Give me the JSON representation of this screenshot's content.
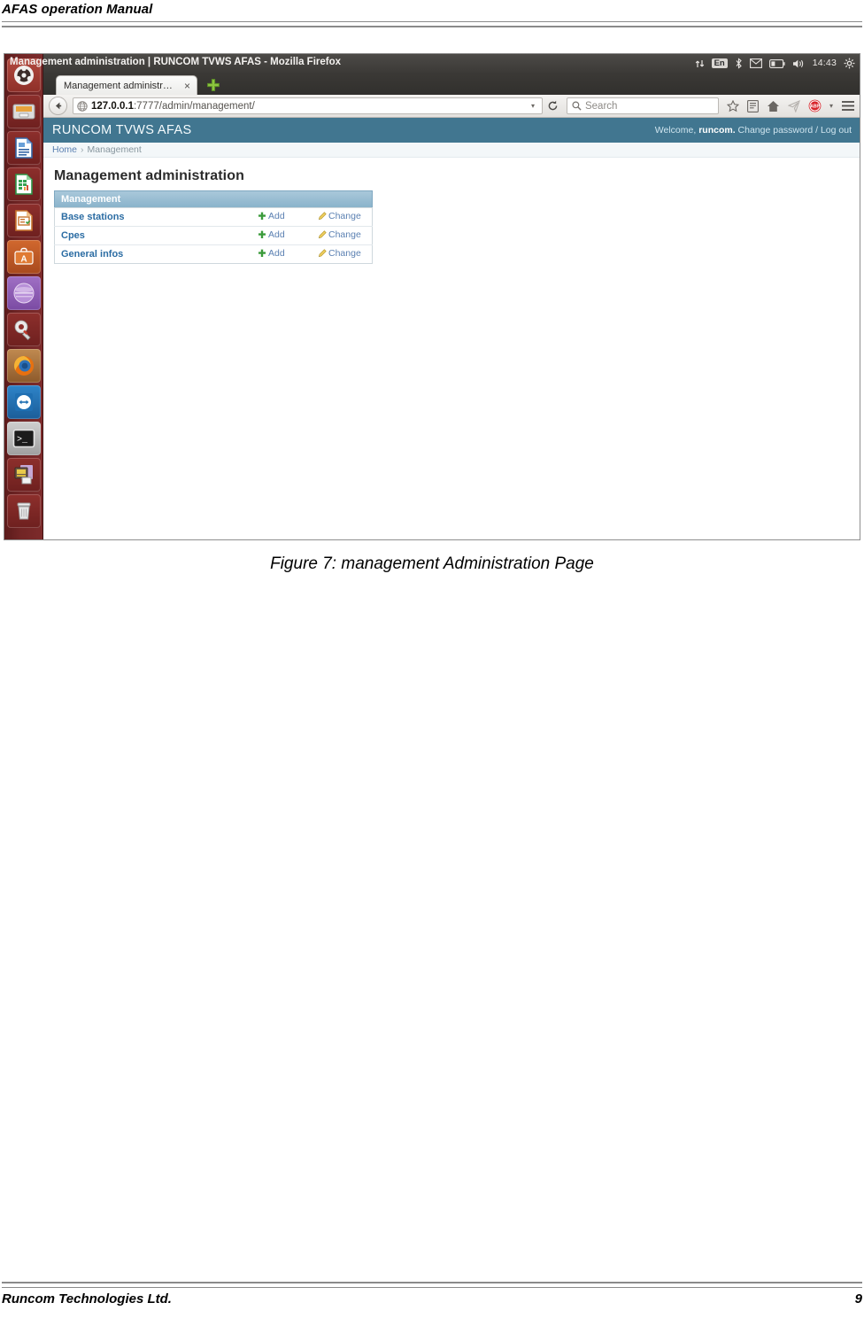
{
  "document": {
    "header_title": "AFAS operation Manual",
    "figure_caption": "Figure 7: management Administration Page",
    "footer_company": "Runcom Technologies Ltd.",
    "page_number": "9"
  },
  "window": {
    "title": "Management administration | RUNCOM TVWS AFAS - Mozilla Firefox"
  },
  "tray": {
    "network_icon": "network-up-down-icon",
    "keyboard_layout": "En",
    "bluetooth_icon": "bluetooth-icon",
    "mail_icon": "mail-icon",
    "battery_icon": "battery-icon",
    "volume_icon": "volume-icon",
    "clock": "14:43",
    "settings_icon": "gear-icon"
  },
  "tabs": [
    {
      "label": "Management administr…",
      "close_label": "×",
      "active": true
    }
  ],
  "new_tab": {
    "label": "+"
  },
  "toolbar": {
    "back_icon": "back-arrow-icon",
    "url_host": "127.0.0.1",
    "url_rest": ":7777/admin/management/",
    "url_full": "127.0.0.1:7777/admin/management/",
    "dropdown_marker": "▾",
    "reload_icon": "reload-icon",
    "search_placeholder": "Search",
    "icons": [
      "star-icon",
      "library-icon",
      "home-icon",
      "send-icon",
      "adblock-icon",
      "menu-icon"
    ],
    "adblock_label": "ABP"
  },
  "launcher": {
    "items": [
      {
        "name": "ubuntu-dash-icon",
        "label": "Dash home"
      },
      {
        "name": "files-icon",
        "label": "Files"
      },
      {
        "name": "libreoffice-writer-icon",
        "label": "LibreOffice Writer"
      },
      {
        "name": "libreoffice-calc-icon",
        "label": "LibreOffice Calc"
      },
      {
        "name": "libreoffice-impress-icon",
        "label": "LibreOffice Impress"
      },
      {
        "name": "ubuntu-software-icon",
        "label": "Ubuntu Software Center"
      },
      {
        "name": "eclipse-icon",
        "label": "Eclipse"
      },
      {
        "name": "system-settings-icon",
        "label": "System Settings"
      },
      {
        "name": "firefox-icon",
        "label": "Firefox"
      },
      {
        "name": "teamviewer-icon",
        "label": "TeamViewer"
      },
      {
        "name": "terminal-icon",
        "label": "Terminal"
      },
      {
        "name": "media-app-icon",
        "label": "Media application"
      },
      {
        "name": "trash-icon",
        "label": "Trash"
      }
    ]
  },
  "app": {
    "brand": "RUNCOM TVWS AFAS",
    "welcome_prefix": "Welcome,",
    "username": "runcom.",
    "change_password": "Change password",
    "separator": "/",
    "logout": "Log out",
    "breadcrumb": {
      "home": "Home",
      "separator": "›",
      "current": "Management"
    },
    "page_title": "Management administration",
    "table": {
      "caption": "Management",
      "rows": [
        {
          "model": "Base stations",
          "add": "Add",
          "change": "Change"
        },
        {
          "model": "Cpes",
          "add": "Add",
          "change": "Change"
        },
        {
          "model": "General infos",
          "add": "Add",
          "change": "Change"
        }
      ]
    }
  },
  "colors": {
    "django_header": "#417690",
    "django_table_header": "#8ab3cb",
    "link_blue": "#2b6ca3",
    "add_green": "#3b9b3b",
    "change_yellow": "#e8c547",
    "launcher_bg": "#712525"
  }
}
